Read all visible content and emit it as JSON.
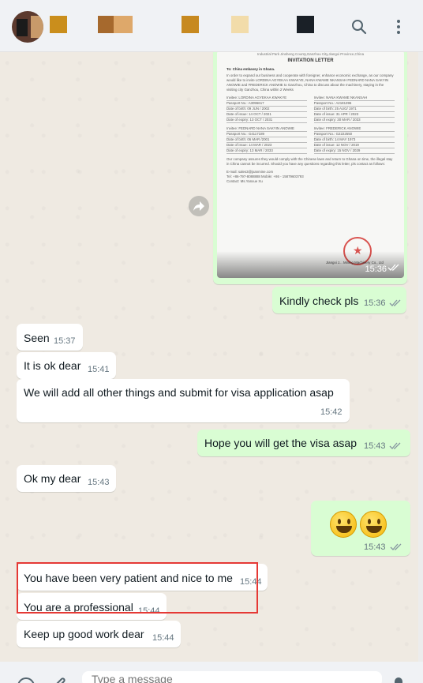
{
  "contact": {
    "avatar_icon": "profile-photo",
    "name_pixel_colors": [
      "#ca8e1c",
      "#a6692d",
      "#dea86a",
      "#c7891f",
      "#f2dcaa",
      "#1a2027"
    ]
  },
  "header": {
    "search_icon": "search-icon",
    "menu_icon": "more-vertical-icon"
  },
  "document": {
    "header_line": "Industrial Park Jinsheng County,Ganzhou City,Jiangxi Province,China",
    "title": "INVITATION LETTER",
    "to": "To: China embassy in Ghana.",
    "paragraph": "In order to expand our business and cooperate with foreigner, enhance economic exchange, as our company would like to invite LORDINA AGYEKAA KWAKYE, NANA KWAME NKANSAH FEDNARD NANA SAKYIN ANOWIE and FREDERICK ANOWIE to Ganzhou, China to discuss about the machinery, staying in the visiting city Ganzhou, China within 2 Weeks",
    "invitees_1": [
      {
        "name": "Invitee: LORDINA AGYEKAA KWAKYE",
        "passport": "Passport No.: A3096617",
        "birth": "Date of birth: 09 JUN / 2002",
        "issue": "Date of issue: 14 OCT / 2021",
        "expiry": "Date of expiry: 13 OCT / 2031"
      },
      {
        "name": "Invitee: NANA KWAME NKANSAH",
        "passport": "Passport No.: A2181396",
        "birth": "Date of birth: 25 AUG/ 1971",
        "issue": "Date of issue: 31 APR / 2023",
        "expiry": "Date of expiry: 30 MAR / 2033"
      }
    ],
    "invitees_2": [
      {
        "name": "Invitee: FEDNARD NANA SAKYIN ANOWIE",
        "passport": "Passport No.: G4117189",
        "birth": "Date of birth: 06 MAR /2001",
        "issue": "Date of issue: 14 MAR / 2023",
        "expiry": "Date of expiry: 13 MAR / 2033"
      },
      {
        "name": "Invitee: FREDERICK ANOWIE",
        "passport": "Passport No.: G2222550",
        "birth": "Date of birth: 14 MAY 1973",
        "issue": "Date of issue: 12 NOV / 2019",
        "expiry": "Date of expiry: 15 NOV / 2029"
      }
    ],
    "closing": "Our company assures they would comply with the Chinese laws and return to Ghana on time, the illegal stay in China cannot be incurred. Should you have any questions regarding this letter, pls contact as follows:",
    "email": "E-mail: sales3@jxanmine.com",
    "tel": "Tel: +86-797-8088888    Mobile: +86 - 15879603793",
    "contact": "Contact: Ms.Yanxue Xu",
    "company": "Jiangxi J... Mining Machinery Co., Ltd",
    "time": "15:36"
  },
  "messages": [
    {
      "id": "m1",
      "dir": "out",
      "text": "Kindly check pls",
      "time": "15:36"
    },
    {
      "id": "m2",
      "dir": "in",
      "text": "Seen",
      "time": "15:37"
    },
    {
      "id": "m3",
      "dir": "in",
      "text": "It is ok dear",
      "time": "15:41"
    },
    {
      "id": "m4",
      "dir": "in",
      "text": "We will add all other things and submit for visa application asap",
      "time": "15:42"
    },
    {
      "id": "m5",
      "dir": "out",
      "text": "Hope you will get the visa asap",
      "time": "15:43"
    },
    {
      "id": "m6",
      "dir": "in",
      "text": "Ok my dear",
      "time": "15:43"
    },
    {
      "id": "m7",
      "dir": "out",
      "text": "😀😀",
      "time": "15:43"
    },
    {
      "id": "m8",
      "dir": "in",
      "text": "You have been very patient and nice to me",
      "time": "15:44"
    },
    {
      "id": "m9",
      "dir": "in",
      "text": "You are a professional",
      "time": "15:44"
    },
    {
      "id": "m10",
      "dir": "in",
      "text": "Keep up good work dear",
      "time": "15:44"
    }
  ],
  "composer": {
    "placeholder": "Type a message",
    "emoji_icon": "emoji-icon",
    "attach_icon": "attach-icon",
    "mic_icon": "mic-icon"
  },
  "colors": {
    "incoming": "#ffffff",
    "outgoing": "#d9fdd3",
    "read_tick": "#8696a0",
    "highlight": "#e53935"
  }
}
